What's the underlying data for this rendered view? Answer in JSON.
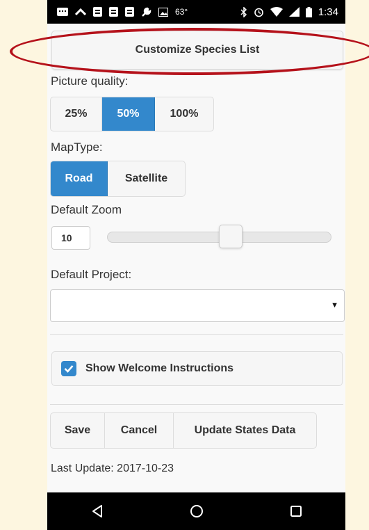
{
  "statusbar": {
    "temperature": "63°",
    "time": "1:34"
  },
  "header": {
    "customize_button": "Customize Species List"
  },
  "picture_quality": {
    "label": "Picture quality:",
    "options": [
      "25%",
      "50%",
      "100%"
    ],
    "selected": "50%"
  },
  "map_type": {
    "label": "MapType:",
    "options": [
      "Road",
      "Satellite"
    ],
    "selected": "Road"
  },
  "default_zoom": {
    "label": "Default Zoom",
    "value": "10",
    "slider_fraction": 0.55
  },
  "default_project": {
    "label": "Default Project:",
    "value": ""
  },
  "welcome": {
    "label": "Show Welcome Instructions",
    "checked": true
  },
  "actions": {
    "save": "Save",
    "cancel": "Cancel",
    "update": "Update States Data"
  },
  "footer": {
    "last_update": "Last Update: 2017-10-23"
  },
  "colors": {
    "accent": "#3388cc",
    "annotation": "#b5121b"
  }
}
